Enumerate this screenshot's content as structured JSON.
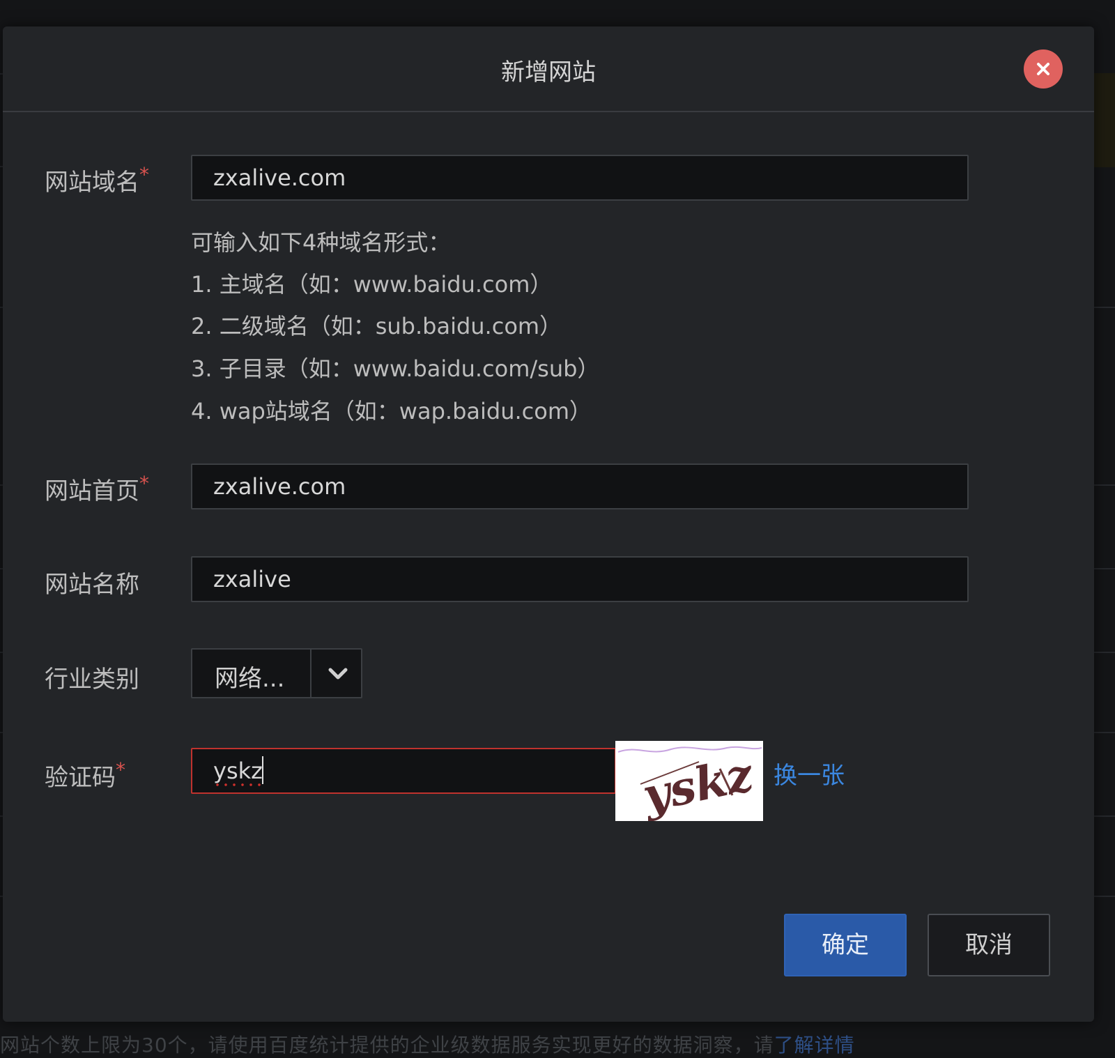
{
  "dialog": {
    "title": "新增网站",
    "close_icon": "close-icon"
  },
  "form": {
    "domain": {
      "label": "网站域名",
      "required_mark": "*",
      "value": "zxalive.com"
    },
    "domain_hint": {
      "intro": "可输入如下4种域名形式：",
      "lines": [
        "1. 主域名（如：www.baidu.com）",
        "2. 二级域名（如：sub.baidu.com）",
        "3. 子目录（如：www.baidu.com/sub）",
        "4. wap站域名（如：wap.baidu.com）"
      ]
    },
    "homepage": {
      "label": "网站首页",
      "required_mark": "*",
      "value": "zxalive.com"
    },
    "site_name": {
      "label": "网站名称",
      "value": "zxalive"
    },
    "industry": {
      "label": "行业类别",
      "selected": "网络...",
      "arrow_icon": "chevron-down-icon"
    },
    "captcha": {
      "label": "验证码",
      "required_mark": "*",
      "value": "yskz",
      "image_text": "yskz",
      "refresh_label": "换一张"
    }
  },
  "actions": {
    "confirm_label": "确定",
    "cancel_label": "取消"
  },
  "background": {
    "notice_text": "网站个数上限为30个，请使用百度统计提供的企业级数据服务实现更好的数据洞察，请",
    "notice_link": "了解详情"
  },
  "colors": {
    "close_button": "#e0625f",
    "primary_button": "#2a5aa8",
    "link": "#3b87e0",
    "required": "#d9534f",
    "error_border": "#c0322e"
  }
}
